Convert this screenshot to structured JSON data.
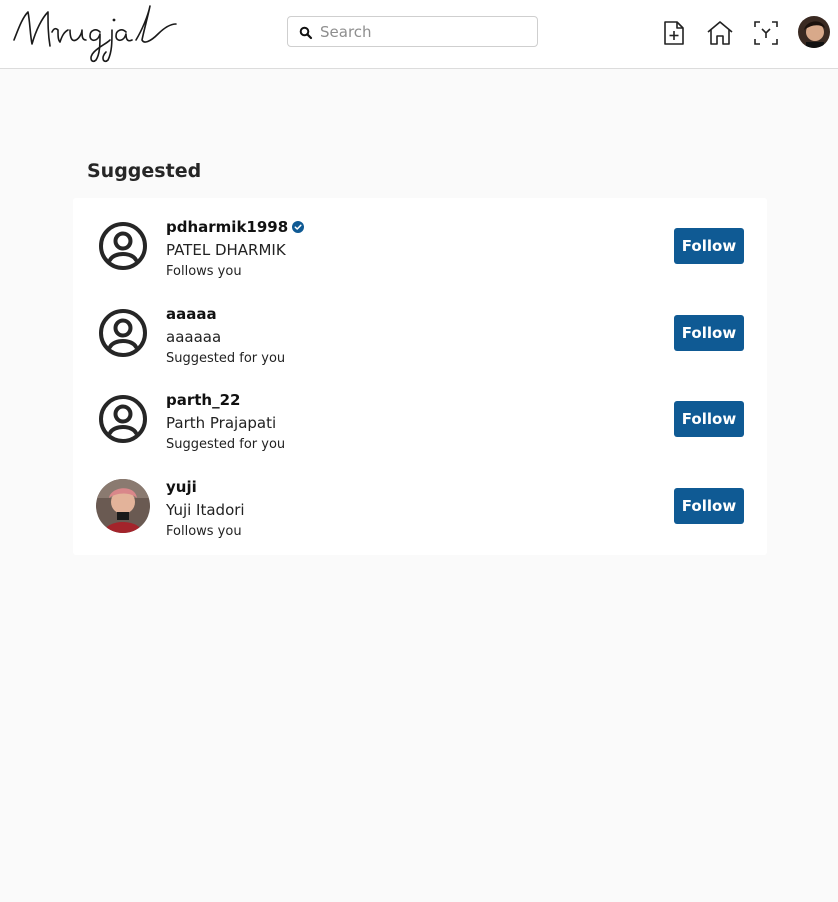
{
  "header": {
    "logo_text": "Mrugjal",
    "search_placeholder": "Search",
    "icons": [
      "new-post-icon",
      "home-icon",
      "scan-icon",
      "profile-avatar"
    ]
  },
  "suggested": {
    "title": "Suggested",
    "follow_label": "Follow",
    "users": [
      {
        "username": "pdharmik1998",
        "verified": true,
        "full_name": "PATEL DHARMIK",
        "note": "Follows you",
        "avatar": "default-user-icon"
      },
      {
        "username": "aaaaa",
        "verified": false,
        "full_name": "aaaaaa",
        "note": "Suggested for you",
        "avatar": "default-user-icon"
      },
      {
        "username": "parth_22",
        "verified": false,
        "full_name": "Parth Prajapati",
        "note": "Suggested for you",
        "avatar": "default-user-icon"
      },
      {
        "username": "yuji",
        "verified": false,
        "full_name": "Yuji Itadori",
        "note": "Follows you",
        "avatar": "photo"
      }
    ]
  },
  "colors": {
    "accent": "#0f5a94",
    "verified": "#0f5a94",
    "page_bg": "#fafafa"
  }
}
